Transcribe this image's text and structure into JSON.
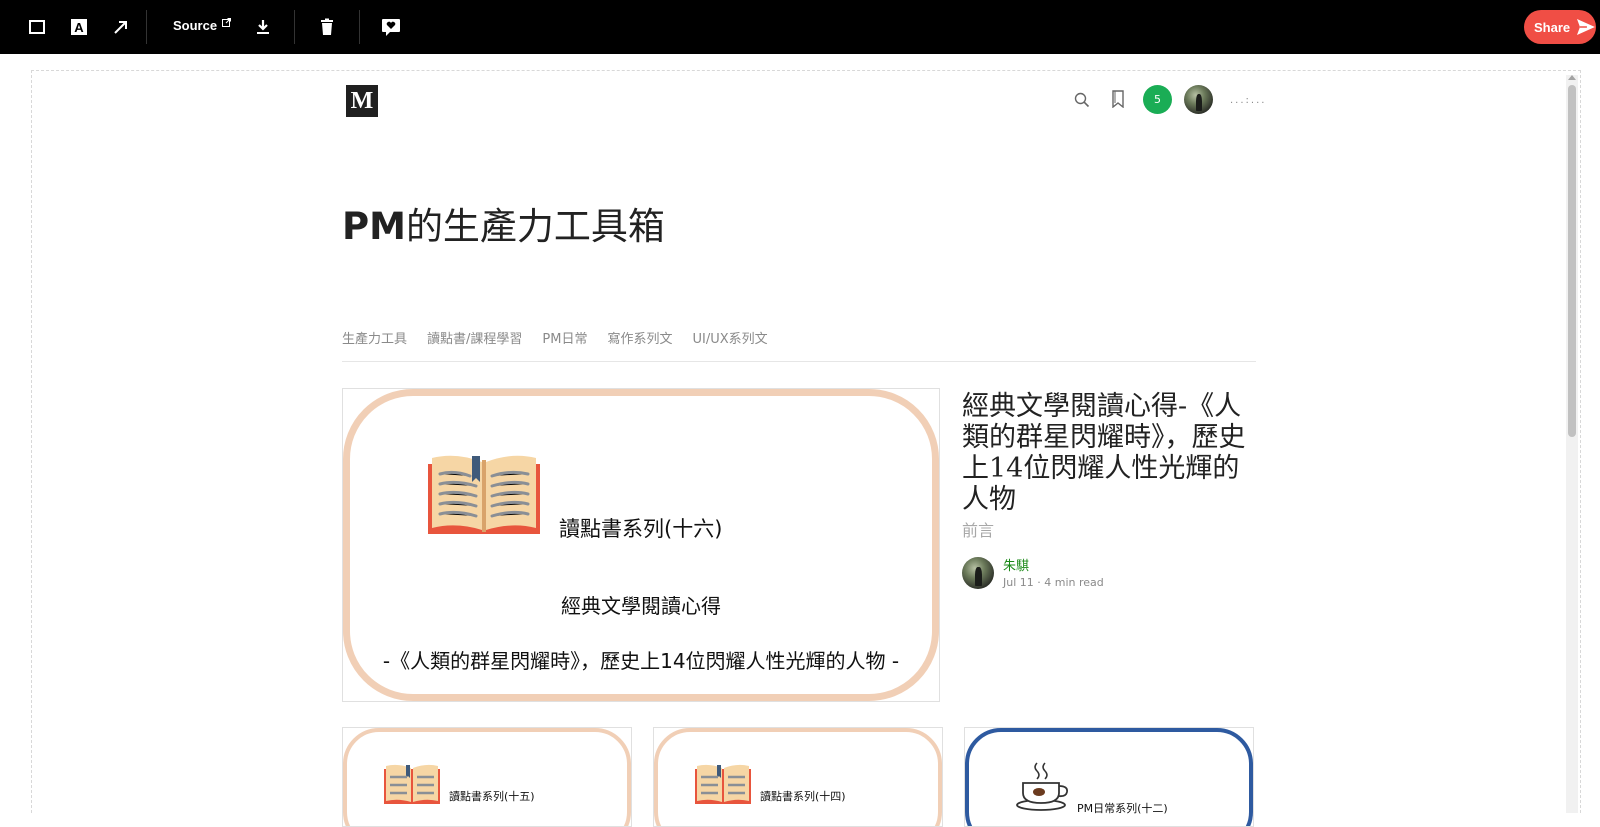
{
  "toolbar": {
    "source_label": "Source",
    "share_label": "Share",
    "icons": [
      "rectangle-icon",
      "text-box-icon",
      "arrow-icon",
      "external-link-icon",
      "download-icon",
      "trash-icon",
      "heart-chat-icon",
      "send-icon"
    ]
  },
  "header": {
    "logo": "M",
    "notification_count": "5",
    "more": "...:..."
  },
  "publication": {
    "title_latin": "PM",
    "title_cjk": "的生產力工具箱",
    "nav": [
      "生產力工具",
      "讀點書/課程學習",
      "PM日常",
      "寫作系列文",
      "UI/UX系列文"
    ]
  },
  "featured": {
    "image_series": "讀點書系列(十六)",
    "image_line2": "經典文學閱讀心得",
    "image_line3": "-《人類的群星閃耀時》，歷史上14位閃耀人性光輝的人物 -",
    "title": "經典文學閱讀心得-《人類的群星閃耀時》，歷史上14位閃耀人性光輝的人物",
    "subtitle": "前言",
    "author": "朱騏",
    "meta": "Jul 11 · 4 min read"
  },
  "cards": [
    {
      "label": "讀點書系列(十五)"
    },
    {
      "label": "讀點書系列(十四)"
    },
    {
      "label": "PM日常系列(十二)"
    }
  ],
  "colors": {
    "toolbar_bg": "#000000",
    "share": "#f04e45",
    "notification": "#1aad55",
    "author": "#1a8917",
    "ring": "#f1cfb6",
    "ring_blue": "#2e5aa0"
  }
}
